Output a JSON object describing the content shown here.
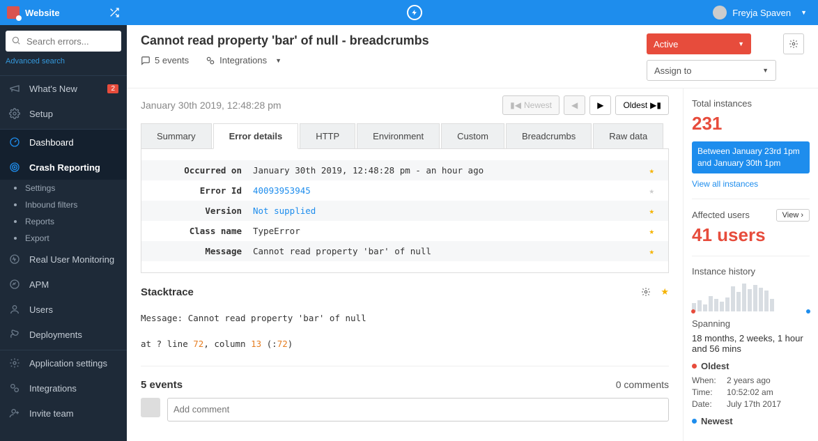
{
  "topbar": {
    "app_name": "Website",
    "user_name": "Freyja Spaven"
  },
  "sidebar": {
    "search_placeholder": "Search errors...",
    "advanced": "Advanced search",
    "whatsnew": "What's New",
    "whatsnew_badge": "2",
    "setup": "Setup",
    "dashboard": "Dashboard",
    "crash": "Crash Reporting",
    "sub": {
      "settings": "Settings",
      "inbound": "Inbound filters",
      "reports": "Reports",
      "export": "Export"
    },
    "rum": "Real User Monitoring",
    "apm": "APM",
    "users": "Users",
    "deploy": "Deployments",
    "appsettings": "Application settings",
    "integrations": "Integrations",
    "invite": "Invite team"
  },
  "header": {
    "title": "Cannot read property 'bar' of null - breadcrumbs",
    "events": "5 events",
    "integrations": "Integrations",
    "status": "Active",
    "assign": "Assign to"
  },
  "timestamp": "January 30th 2019, 12:48:28 pm",
  "navbtns": {
    "newest": "Newest",
    "oldest": "Oldest"
  },
  "tabs": {
    "summary": "Summary",
    "details": "Error details",
    "http": "HTTP",
    "env": "Environment",
    "custom": "Custom",
    "bread": "Breadcrumbs",
    "raw": "Raw data"
  },
  "details": {
    "occurred_l": "Occurred on",
    "occurred_v": "January 30th 2019, 12:48:28 pm - an hour ago",
    "errorid_l": "Error Id",
    "errorid_v": "40093953945",
    "version_l": "Version",
    "version_v": "Not supplied",
    "class_l": "Class name",
    "class_v": "TypeError",
    "message_l": "Message",
    "message_v": "Cannot read property 'bar' of null"
  },
  "stack": {
    "heading": "Stacktrace",
    "msg_prefix": "Message: ",
    "msg": "Cannot read property 'bar' of null",
    "at_prefix": "at ? line ",
    "line": "72",
    "col_prefix": ", column ",
    "col": "13",
    "paren_open": " (:",
    "paren_num": "72",
    "paren_close": ")"
  },
  "events": {
    "count": "5 events",
    "comments": "0 comments",
    "placeholder": "Add comment"
  },
  "side": {
    "total_l": "Total instances",
    "total_v": "231",
    "range": "Between January 23rd 1pm and January 30th 1pm",
    "viewall": "View all instances",
    "affected_l": "Affected users",
    "affected_v": "41 users",
    "view": "View",
    "history": "Instance history",
    "spanning_l": "Spanning",
    "spanning_v": "18 months, 2 weeks, 1 hour and 56 mins",
    "oldest": "Oldest",
    "when_l": "When:",
    "when_v": "2 years ago",
    "time_l": "Time:",
    "time_v": "10:52:02 am",
    "date_l": "Date:",
    "date_v": "July 17th 2017",
    "newest": "Newest"
  },
  "chart_data": {
    "type": "bar",
    "values": [
      12,
      16,
      10,
      22,
      18,
      14,
      20,
      36,
      28,
      40,
      32,
      38,
      34,
      30,
      18
    ]
  }
}
